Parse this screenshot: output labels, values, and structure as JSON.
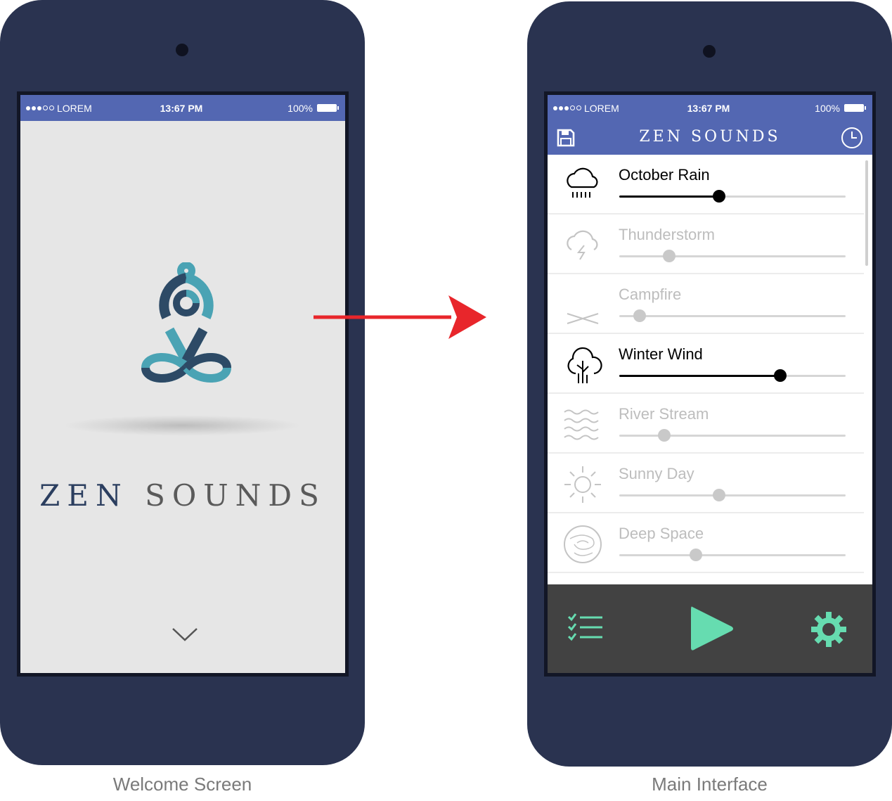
{
  "welcome": {
    "status": {
      "carrier": "LOREM",
      "time": "13:67 PM",
      "battery": "100%"
    },
    "title_part1": "ZEN",
    "title_part2": "SOUNDS"
  },
  "main": {
    "status": {
      "carrier": "LOREM",
      "time": "13:67 PM",
      "battery": "100%"
    },
    "app_title": "ZEN SOUNDS",
    "sounds": [
      {
        "label": "October Rain",
        "icon": "rain-cloud-icon",
        "active": true,
        "level": 0.44
      },
      {
        "label": "Thunderstorm",
        "icon": "thunder-cloud-icon",
        "active": false,
        "level": 0.22
      },
      {
        "label": "Campfire",
        "icon": "campfire-icon",
        "active": false,
        "level": 0.09
      },
      {
        "label": "Winter Wind",
        "icon": "wind-tree-icon",
        "active": true,
        "level": 0.71
      },
      {
        "label": "River Stream",
        "icon": "waves-icon",
        "active": false,
        "level": 0.2
      },
      {
        "label": "Sunny Day",
        "icon": "sun-icon",
        "active": false,
        "level": 0.44
      },
      {
        "label": "Deep Space",
        "icon": "planet-icon",
        "active": false,
        "level": 0.34
      }
    ],
    "bottom": {
      "playlist": "playlist-icon",
      "play": "play-icon",
      "settings": "gear-icon"
    }
  },
  "captions": {
    "left": "Welcome Screen",
    "right": "Main Interface"
  },
  "colors": {
    "frame": "#2a3350",
    "statusbar": "#5367b2",
    "accent": "#66dcb0",
    "logo_light": "#4aa3b4",
    "logo_dark": "#2d4a66"
  }
}
